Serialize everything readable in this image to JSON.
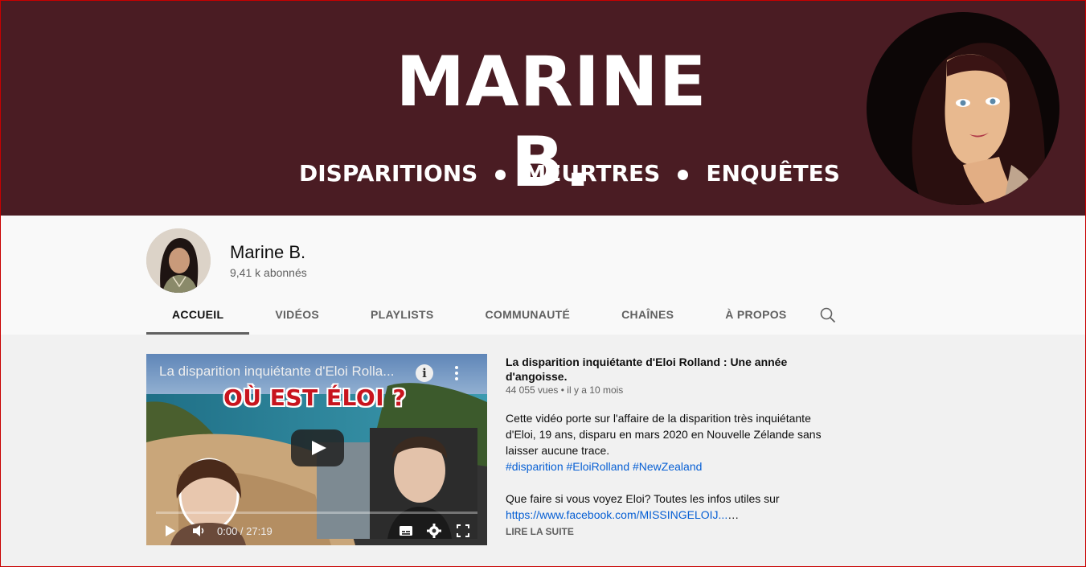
{
  "banner": {
    "title": "MARINE B.",
    "tagline": [
      "DISPARITIONS",
      "MEURTRES",
      "ENQUÊTES"
    ]
  },
  "channel": {
    "name": "Marine B.",
    "subscribers": "9,41 k abonnés"
  },
  "tabs": [
    {
      "label": "ACCUEIL",
      "active": true
    },
    {
      "label": "VIDÉOS",
      "active": false
    },
    {
      "label": "PLAYLISTS",
      "active": false
    },
    {
      "label": "COMMUNAUTÉ",
      "active": false
    },
    {
      "label": "CHAÎNES",
      "active": false
    },
    {
      "label": "À PROPOS",
      "active": false
    }
  ],
  "player": {
    "title": "La disparition inquiétante d'Eloi Rolla...",
    "thumbnail_headline": "OÙ EST ÉLOI ?",
    "time": "0:00 / 27:19",
    "icons": [
      "info-icon",
      "more-vert-icon",
      "play-icon",
      "volume-icon",
      "subtitles-icon",
      "settings-icon",
      "fullscreen-icon"
    ]
  },
  "featured": {
    "title": "La disparition inquiétante d'Eloi Rolland : Une année d'angoisse.",
    "views": "44 055 vues",
    "separator": "•",
    "date": "il y a 10 mois",
    "desc_line1": "Cette vidéo porte sur l'affaire de la disparition très inquiétante d'Eloi, 19 ans, disparu en mars 2020 en Nouvelle Zélande sans laisser aucune trace.",
    "hashtags": [
      "#disparition",
      "#EloiRolland",
      "#NewZealand"
    ],
    "desc_line2": "Que faire si vous voyez Eloi? Toutes les infos utiles sur",
    "link": "https://www.facebook.com/MISSINGELOIJ...",
    "link_suffix": "…",
    "read_more": "LIRE LA SUITE"
  },
  "colors": {
    "banner_bg": "#4a1c23",
    "headline_red": "#c8141e",
    "link_blue": "#065fd4"
  }
}
